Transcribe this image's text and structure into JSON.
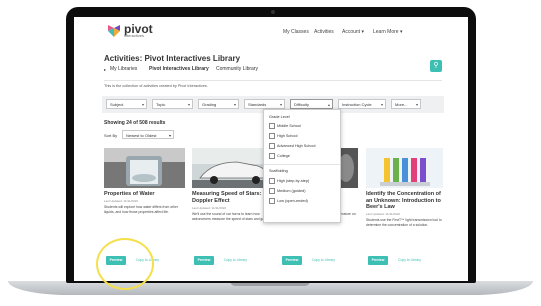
{
  "header": {
    "logo_text": "pivot",
    "logo_sub": "interactives",
    "nav": [
      "My Classes",
      "Activities",
      "Account ▾",
      "Learn More ▾"
    ]
  },
  "page": {
    "title": "Activities: Pivot Interactives Library",
    "breadcrumbs": [
      "My Libraries",
      "Pivot Interactives Library",
      "Community Library"
    ],
    "description": "This is the collection of activities created by Pivot Interactives.",
    "results_text": "Showing 24 of 508 results",
    "sort_label": "Sort By",
    "sort_value": "Newest to Oldest"
  },
  "filters": [
    "Subject",
    "Topic",
    "Grading",
    "Standards",
    "Difficulty",
    "Instruction Cycle",
    "More..."
  ],
  "difficulty_dropdown": {
    "grade_header": "Grade Level",
    "grade_items": [
      "Middle School",
      "High School",
      "Advanced High School",
      "College"
    ],
    "scaffold_header": "Scaffolding",
    "scaffold_items": [
      "High (step-by-step)",
      "Medium (guided)",
      "Low (open-ended)"
    ]
  },
  "cards": [
    {
      "title": "Properties of Water",
      "updated": "Last Updated: 11/11/2022",
      "desc": "Students will explore how water differs from other liquids, and how those properties affect life.",
      "preview": "Preview",
      "copy": "Copy to Library"
    },
    {
      "title": "Measuring Speed of Stars: The Doppler Effect",
      "updated": "Last Updated: 11/11/2022",
      "desc": "We'll use the sound of car horns to learn how astronomers measure the speed of stars and galaxies.",
      "preview": "Preview",
      "copy": "Copy to Library"
    },
    {
      "title": "...ature",
      "updated": "",
      "desc": "Students will explore the effect of temperature on the physiology of daphnia.",
      "preview": "Preview",
      "copy": "Copy to Library"
    },
    {
      "title": "Identify the Concentration of an Unknown: Introduction to Beer's Law",
      "updated": "Last Updated: 11/11/2022",
      "desc": "Students use the FirstT™ light transmission tool to determine the concentration of a solution.",
      "preview": "Preview",
      "copy": "Copy to Library"
    }
  ],
  "colors": {
    "accent": "#3dbfb4",
    "highlight_circle": "#f4e04d"
  }
}
